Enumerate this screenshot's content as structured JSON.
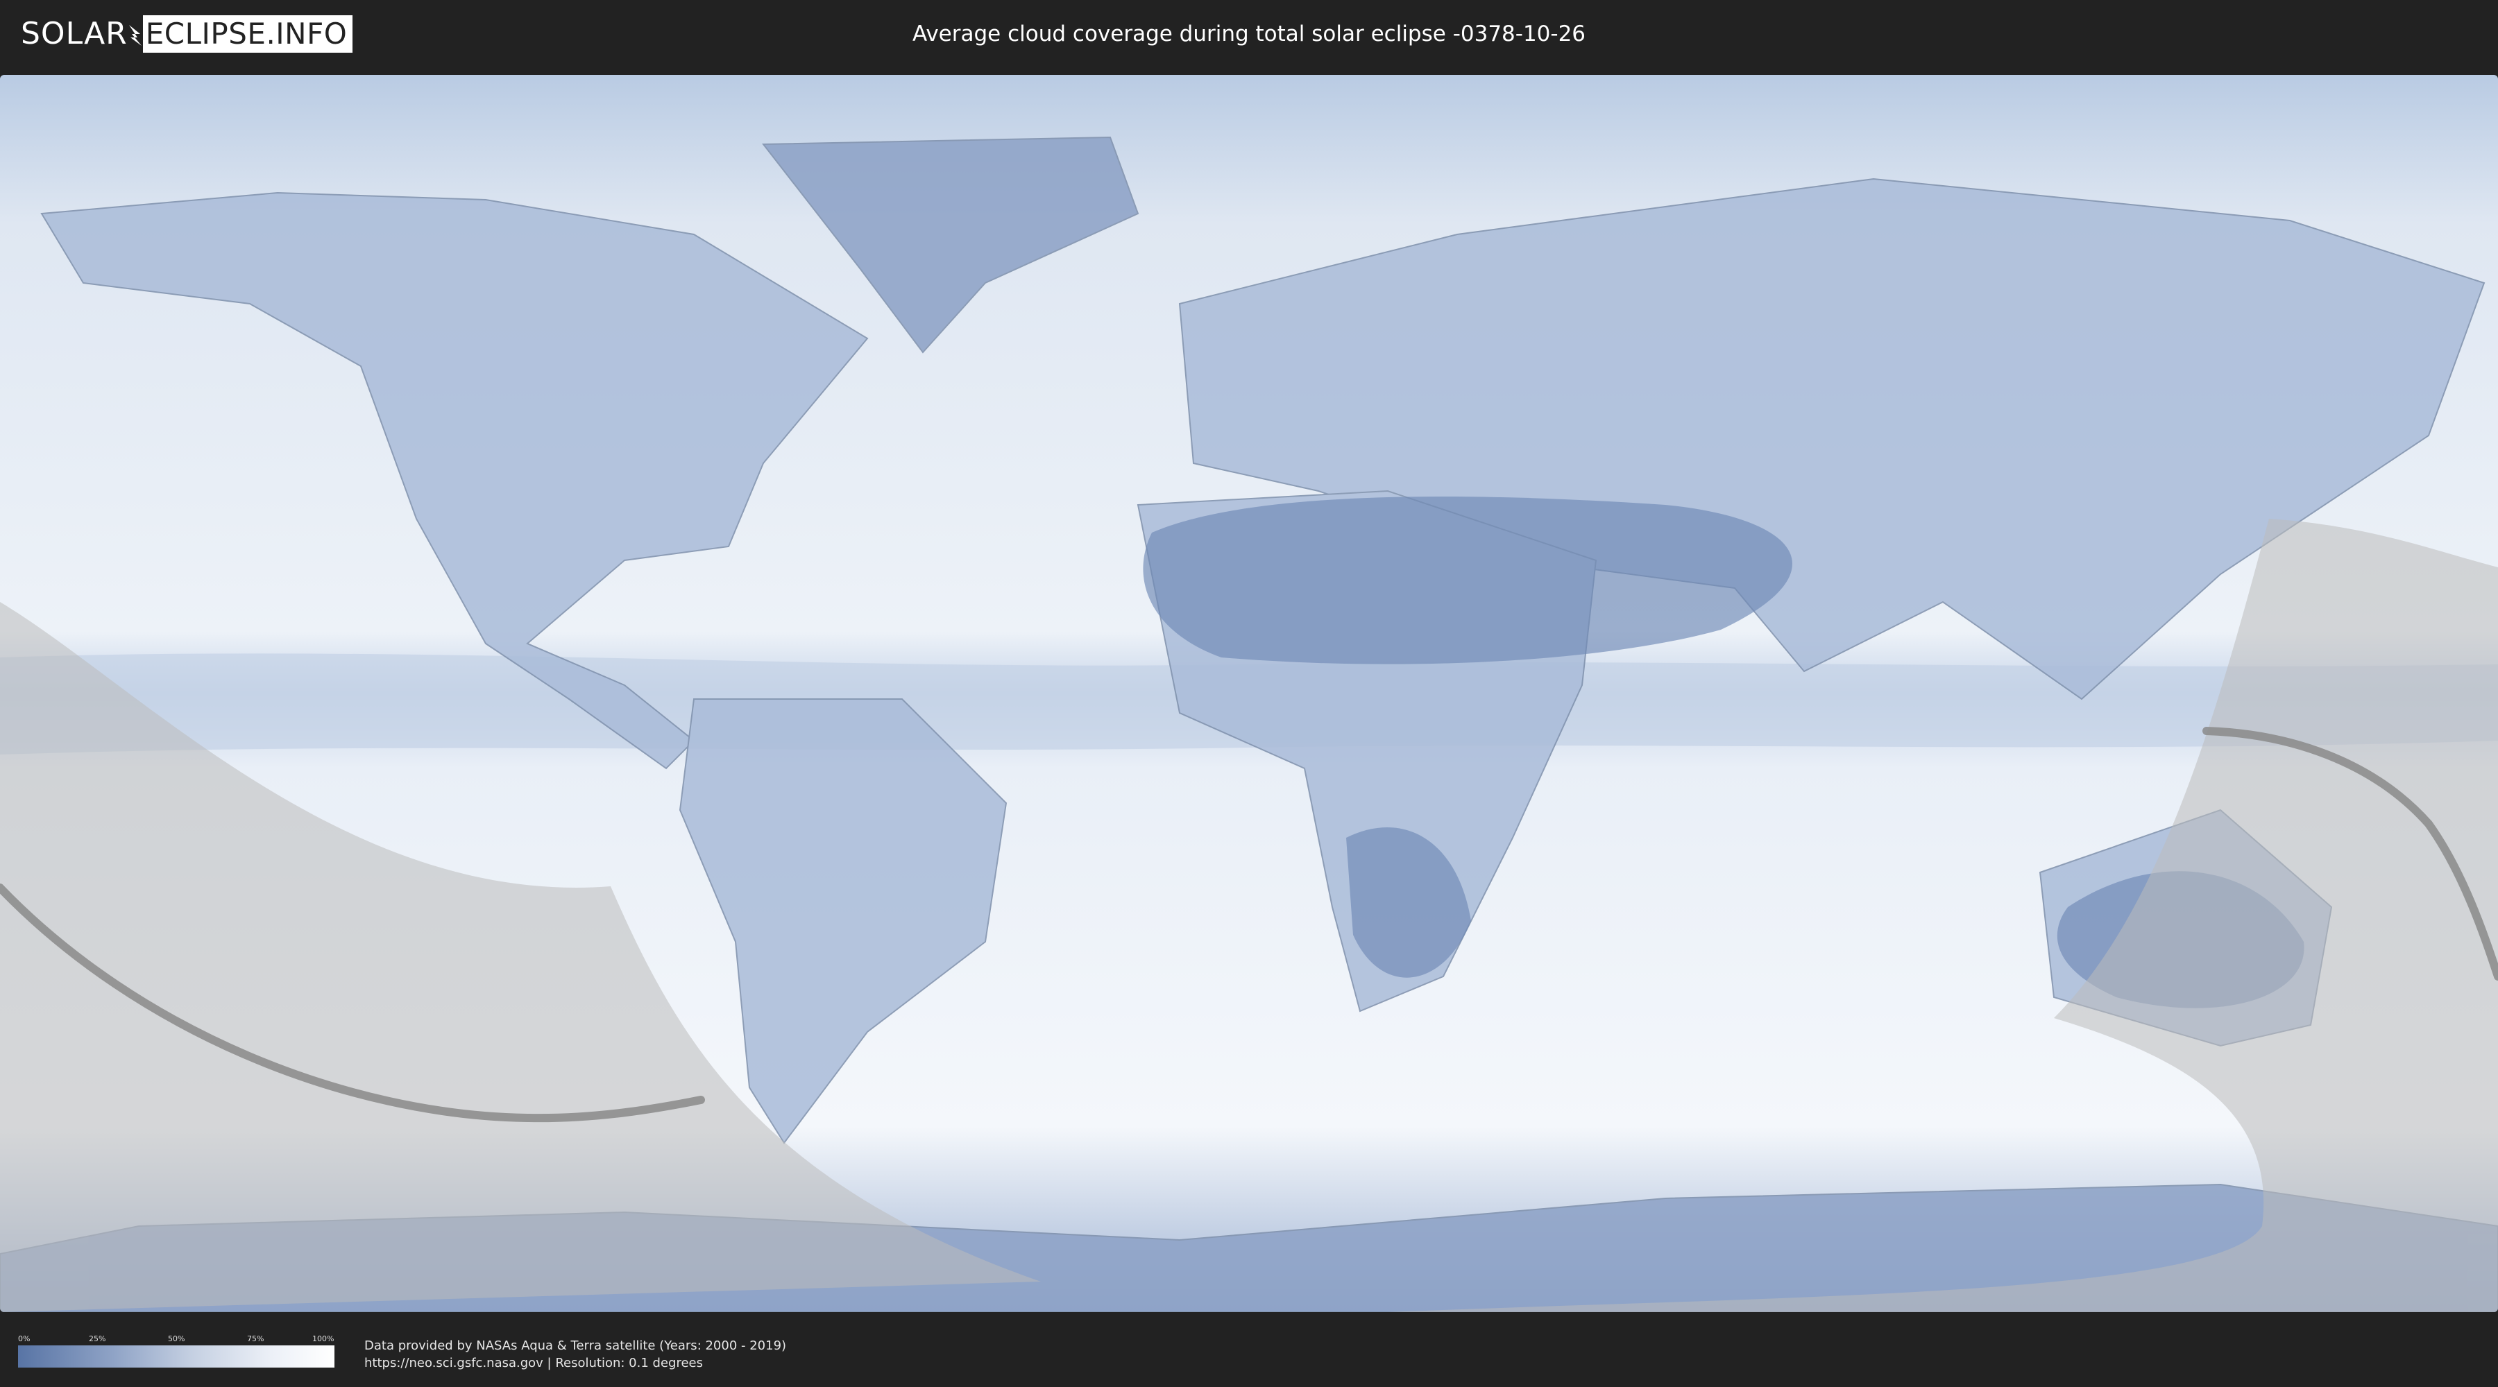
{
  "header": {
    "logo_part1": "SOLAR",
    "logo_part2": "ECLIPSE.INFO",
    "title": "Average cloud coverage during total solar eclipse -0378-10-26"
  },
  "map": {
    "ocean_color": "#e4ebf5",
    "land_color": "#a9bbd8",
    "cloudy_desert_color": "#6f88b6",
    "shadow_color": "#bdbdbd",
    "path_color": "#8a8a8a"
  },
  "legend": {
    "ticks": [
      "0%",
      "25%",
      "50%",
      "75%",
      "100%"
    ],
    "tick_values": [
      0,
      0.25,
      0.5,
      0.75,
      1
    ]
  },
  "footer": {
    "line1": "Data provided by NASAs Aqua & Terra satellite (Years: 2000 - 2019)",
    "line2": "https://neo.sci.gsfc.nasa.gov | Resolution: 0.1 degrees"
  }
}
